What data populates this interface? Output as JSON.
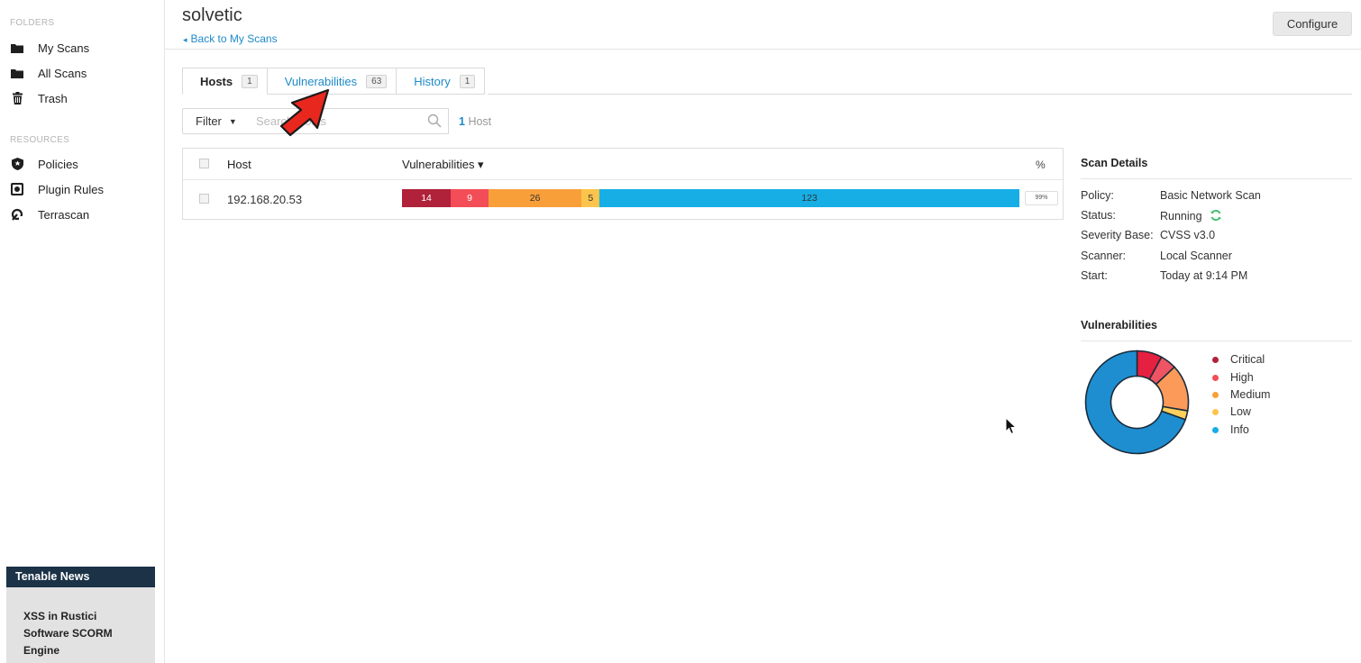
{
  "sidebar": {
    "folders_heading": "FOLDERS",
    "folders": [
      {
        "label": "My Scans",
        "icon": "folder-icon"
      },
      {
        "label": "All Scans",
        "icon": "folder-icon"
      },
      {
        "label": "Trash",
        "icon": "trash-icon"
      }
    ],
    "resources_heading": "RESOURCES",
    "resources": [
      {
        "label": "Policies",
        "icon": "shield-icon"
      },
      {
        "label": "Plugin Rules",
        "icon": "plugin-icon"
      },
      {
        "label": "Terrascan",
        "icon": "terrascan-icon"
      }
    ],
    "news": {
      "title": "Tenable News",
      "headline": "XSS in Rustici Software SCORM Engine"
    }
  },
  "header": {
    "title": "solvetic",
    "back_label": "Back to My Scans",
    "configure_label": "Configure"
  },
  "tabs": [
    {
      "label": "Hosts",
      "count": "1",
      "active": true
    },
    {
      "label": "Vulnerabilities",
      "count": "63",
      "active": false
    },
    {
      "label": "History",
      "count": "1",
      "active": false
    }
  ],
  "filter": {
    "label": "Filter",
    "search_placeholder": "Search Hosts",
    "host_count_number": "1",
    "host_count_label": "Host"
  },
  "table": {
    "columns": {
      "host": "Host",
      "vulnerabilities": "Vulnerabilities ▾",
      "percent": "%"
    },
    "rows": [
      {
        "host": "192.168.20.53",
        "severity_counts": {
          "critical": "14",
          "high": "9",
          "medium": "26",
          "low": "5",
          "info": "123"
        },
        "severity_fractions": [
          0.079,
          0.061,
          0.151,
          0.029,
          0.68
        ],
        "percent": "99%"
      }
    ]
  },
  "scan_details": {
    "title": "Scan Details",
    "rows": [
      {
        "key": "Policy:",
        "value": "Basic Network Scan"
      },
      {
        "key": "Status:",
        "value": "Running"
      },
      {
        "key": "Severity Base:",
        "value": "CVSS v3.0"
      },
      {
        "key": "Scanner:",
        "value": "Local Scanner"
      },
      {
        "key": "Start:",
        "value": "Today at 9:14 PM"
      }
    ]
  },
  "vuln_chart": {
    "title": "Vulnerabilities",
    "legend": [
      "Critical",
      "High",
      "Medium",
      "Low",
      "Info"
    ]
  },
  "colors": {
    "critical": "#b0213a",
    "high": "#f34d58",
    "medium": "#f89f3a",
    "low": "#fcc44c",
    "info": "#16aee5",
    "donut_critical": "#e52040",
    "donut_high": "#ee5463",
    "donut_medium": "#fc9a5a",
    "donut_low": "#fdd05c",
    "donut_info": "#1e8ed0",
    "link": "#1d8ac8",
    "running": "#3dbd64"
  },
  "chart_data": {
    "type": "pie",
    "categories": [
      "Critical",
      "High",
      "Medium",
      "Low",
      "Info"
    ],
    "values": [
      14,
      9,
      26,
      5,
      123
    ],
    "legend": "right"
  }
}
